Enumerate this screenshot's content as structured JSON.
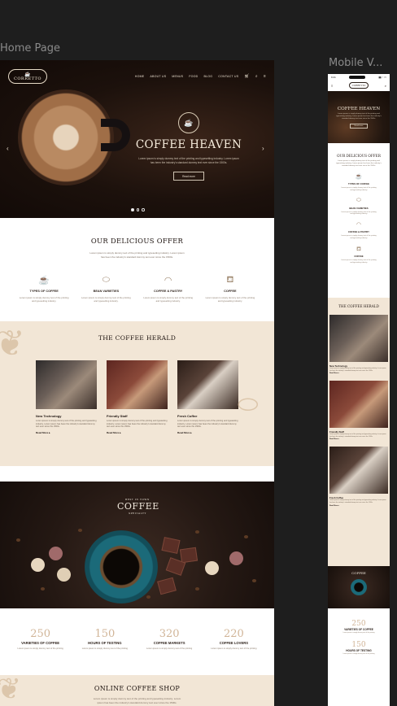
{
  "frames": {
    "home_label": "Home Page",
    "mobile_label": "Mobile V..."
  },
  "brand": {
    "logo_text": "CORRETTO",
    "accent": "#d1b598",
    "dark": "#1e1410",
    "cream": "#f2e6d6"
  },
  "nav": {
    "items": [
      "HOME",
      "ABOUT US",
      "MENUS",
      "FOOD",
      "BLOG",
      "CONTACT US"
    ],
    "icons": [
      "cart-icon",
      "search-icon",
      "menu-icon"
    ]
  },
  "hero": {
    "title": "COFFEE HEAVEN",
    "subtitle": "Lorem ipsum is simply dummy text of the printing and typesetting industry. Lorem ipsum has been the industry's standard dummy text ever since the 1500s.",
    "button": "Read more",
    "slides": 3,
    "active_slide": 1
  },
  "offer": {
    "title": "OUR DELICIOUS OFFER",
    "text": "Lorem ipsum is simply dummy text of the printing and typesetting industry. Lorem ipsum has been the industry's standard dummy text ever since the 1500s.",
    "items": [
      {
        "icon": "coffee-cup-icon",
        "label": "TYPES OF COFFEE",
        "desc": "Lorem ipsum is simply dummy text of the printing and typesetting industry."
      },
      {
        "icon": "coffee-bean-icon",
        "label": "BEAN VARIETIES",
        "desc": "Lorem ipsum is simply dummy text of the printing and typesetting industry."
      },
      {
        "icon": "croissant-icon",
        "label": "COFFEE & PASTRY",
        "desc": "Lorem ipsum is simply dummy text of the printing and typesetting industry."
      },
      {
        "icon": "to-go-cup-icon",
        "label": "COFFEE",
        "desc": "Lorem ipsum is simply dummy text of the printing and typesetting industry."
      }
    ]
  },
  "herald": {
    "title": "THE COFFEE HERALD",
    "cards": [
      {
        "title": "New Technology",
        "desc": "Lorem ipsum is simply dummy text of the printing and typesetting industry. Lorem ipsum has been the industry's standard dummy text ever since the 1500s.",
        "link": "Read More ▸"
      },
      {
        "title": "Friendly Staff",
        "desc": "Lorem ipsum is simply dummy text of the printing and typesetting industry. Lorem ipsum has been the industry's standard dummy text ever since the 1500s.",
        "link": "Read More ▸"
      },
      {
        "title": "Fresh Coffee",
        "desc": "Lorem ipsum is simply dummy text of the printing and typesetting industry. Lorem ipsum has been the industry's standard dummy text ever since the 1500s.",
        "link": "Read More ▸"
      }
    ]
  },
  "banner": {
    "badge_title": "COFFEE",
    "badge_top": "BEST IN TOWN",
    "badge_ribbon": "SPECIALTY"
  },
  "stats": [
    {
      "number": "250",
      "label": "VARIETIES OF COFFEE",
      "desc": "Lorem ipsum is simply dummy text of the printing"
    },
    {
      "number": "150",
      "label": "HOURS OF TESTING",
      "desc": "Lorem ipsum is simply dummy text of the printing"
    },
    {
      "number": "320",
      "label": "COFFEE MARKETS",
      "desc": "Lorem ipsum is simply dummy text of the printing"
    },
    {
      "number": "220",
      "label": "COFFEE LOVERS",
      "desc": "Lorem ipsum is simply dummy text of the printing"
    }
  ],
  "shop": {
    "title": "ONLINE COFFEE SHOP",
    "text": "Lorem ipsum is simply dummy text of the printing and typesetting industry. Lorem ipsum has been the industry's standard dummy text ever since the 1500s.",
    "bag_colors": [
      "#5b7a8a",
      "#a57a3e",
      "#8a5a3a",
      "#6a4a6a"
    ]
  },
  "mobile": {
    "time": "9:41",
    "status_icons": "▮▮ ◔ ▭"
  }
}
